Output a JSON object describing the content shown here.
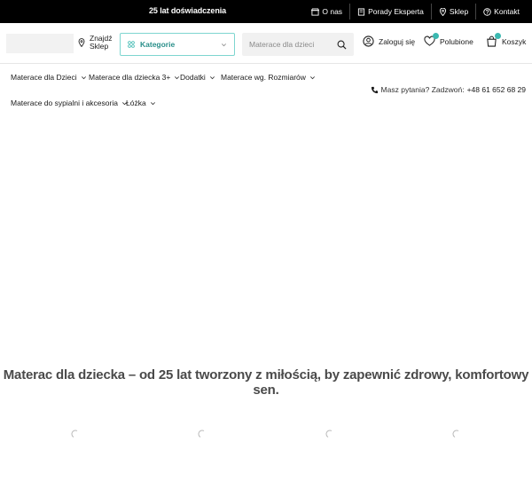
{
  "topbar": {
    "promo": "25 lat doświadczenia",
    "links": [
      {
        "label": "O nas",
        "icon": "store-icon"
      },
      {
        "label": "Porady Eksperta",
        "icon": "book-icon"
      },
      {
        "label": "Sklep",
        "icon": "location-pin-icon"
      },
      {
        "label": "Kontakt",
        "icon": "help-circle-icon"
      }
    ]
  },
  "header": {
    "find_store_line1": "Znajdź",
    "find_store_line2": "Sklep",
    "categories_label": "Kategorie",
    "search_placeholder": "Materace dla dzieci",
    "login_label": "Zaloguj się",
    "favorites_label": "Polubione",
    "cart_label": "Koszyk"
  },
  "nav": {
    "items": [
      "Materace dla Dzieci",
      "Materace dla dziecka 3+",
      "Dodatki",
      "Materace wg. Rozmiarów",
      "Materace do sypialni i akcesoria",
      "Łóżka"
    ],
    "phone_prompt": "Masz pytania? Zadzwoń:",
    "phone_number": "+48 61 652 68 29"
  },
  "hero": {
    "tagline": "Materac dla dziecka – od 25 lat tworzony z miłością, by zapewnić zdrowy, komfortowy sen."
  },
  "colors": {
    "accent": "#3bb8b0",
    "accent_text": "#2a8f8a",
    "topbar_bg": "#000000"
  }
}
